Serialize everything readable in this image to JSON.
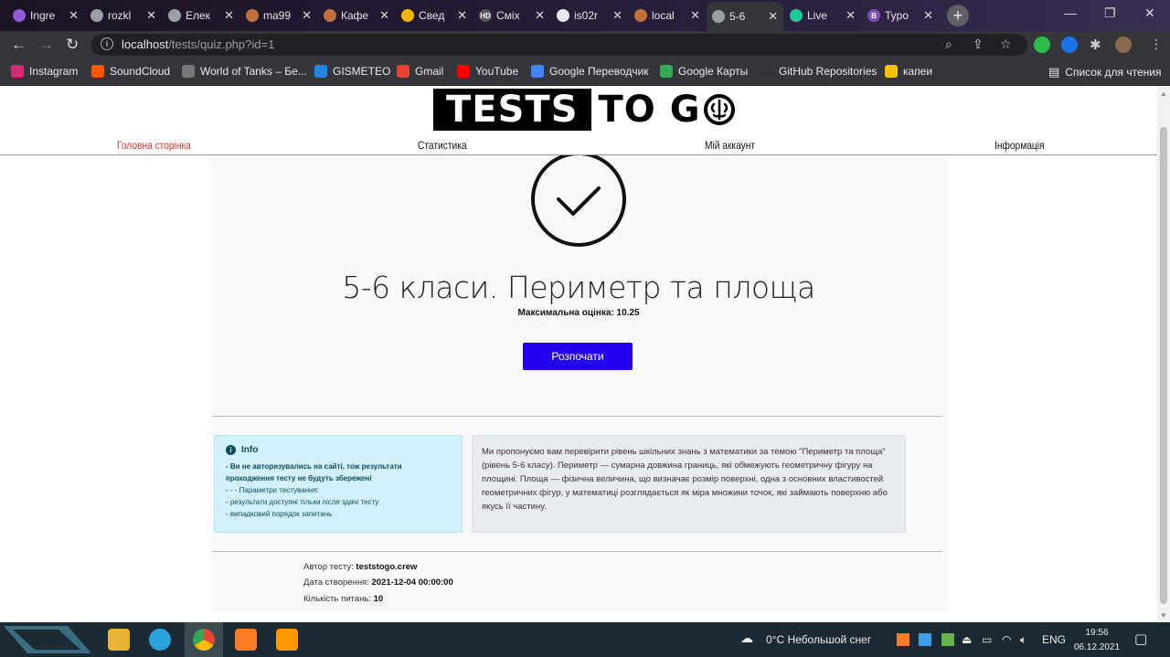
{
  "browser": {
    "tabs": [
      {
        "title": "Ingre",
        "color": "#8e5bd6"
      },
      {
        "title": "rozkl",
        "color": "#9aa0a6"
      },
      {
        "title": "Елек",
        "color": "#9aa0a6"
      },
      {
        "title": "ma99",
        "color": "#c0703a"
      },
      {
        "title": "Кафе",
        "color": "#c0703a"
      },
      {
        "title": "Свед",
        "color": "#f4b400"
      },
      {
        "title": "Сміх",
        "color": "#555555",
        "fav_text": "HD"
      },
      {
        "title": "is02r",
        "color": "#e8eaed"
      },
      {
        "title": "local",
        "color": "#c0703a"
      },
      {
        "title": "5-6",
        "color": "#9aa0a6",
        "active": true
      },
      {
        "title": "Live",
        "color": "#20c997"
      },
      {
        "title": "Typo",
        "color": "#7952b3",
        "fav_text": "B"
      }
    ],
    "new_tab": "+",
    "window_controls": {
      "minimize": "—",
      "maximize": "❐",
      "close": "✕"
    },
    "address": {
      "host": "localhost",
      "path": "/tests/quiz.php?id=1"
    },
    "bookmarks": [
      {
        "label": "Instagram",
        "color": "#d62976"
      },
      {
        "label": "SoundCloud",
        "color": "#ff5500"
      },
      {
        "label": "World of Tanks – Бе...",
        "color": "#777777"
      },
      {
        "label": "GISMETEO",
        "color": "#1e88e5"
      },
      {
        "label": "Gmail",
        "color": "#ea4335"
      },
      {
        "label": "YouTube",
        "color": "#ff0000"
      },
      {
        "label": "Google Переводчик",
        "color": "#4285f4"
      },
      {
        "label": "Google Карты",
        "color": "#34a853"
      },
      {
        "label": "GitHub Repositories",
        "color": "#333333"
      },
      {
        "label": "капеи",
        "color": "#f4c20d"
      }
    ],
    "reading_list": "Список для чтения"
  },
  "site": {
    "logo": {
      "block_text": "TESTS",
      "rest_text": "TO G"
    },
    "nav": [
      {
        "label": "Головна сторінка",
        "active": true
      },
      {
        "label": "Статистика"
      },
      {
        "label": "Мій аккаунт"
      },
      {
        "label": "Інформація"
      }
    ]
  },
  "quiz": {
    "title": "5-6 класи. Периметр та площа",
    "max_score": "Максимальна оцінка: 10.25",
    "start_button": "Розпочати",
    "info": {
      "heading": "Info",
      "warning": "- Ви не авторизувались на сайті, тож результати проходження тесту не будуть збережені",
      "params": "- - - Параметри тестування:",
      "line1": "- результати доступні тільки після здачі тесту",
      "line2": "- випадковий порядок запитань"
    },
    "description": "Ми пропонуємо вам перевірити рівень шкільних знань з математики за темою \"Периметр та площа\" (рівень 5-6 класу). Периметр — сумарна довжина границь, які обмежують геометричну фігуру на площині. Площа — фізична величина, що визначає розмір поверхні, одна з основних властивостей геометричних фігур, у математиці розглядається як міра множини точок, які займають поверхню або якусь її частину.",
    "author_label": "Автор тесту:",
    "author": "teststogo.crew",
    "created_label": "Дата створення:",
    "created": "2021-12-04 00:00:00",
    "count_label": "Кількість питань:",
    "count": "10"
  },
  "taskbar": {
    "weather": "0°C  Небольшой снег",
    "lang": "ENG",
    "time": "19:56",
    "date": "06.12.2021"
  }
}
